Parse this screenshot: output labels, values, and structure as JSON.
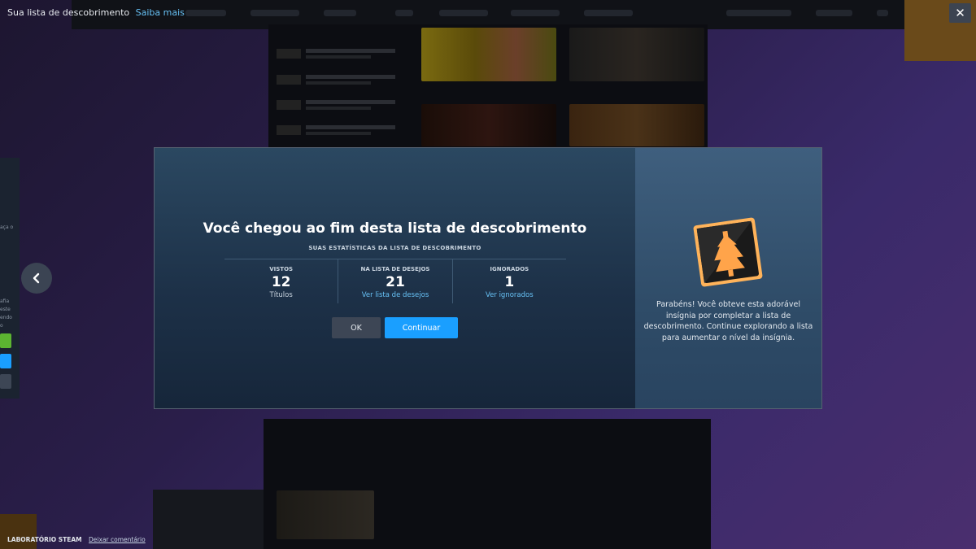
{
  "top_bar": {
    "title": "Sua lista de descobrimento",
    "learn_more": "Saiba mais"
  },
  "dialog": {
    "title": "Você chegou ao fim desta lista de descobrimento",
    "subtitle": "SUAS ESTATÍSTICAS DA LISTA DE DESCOBRIMENTO",
    "stats": [
      {
        "label": "VISTOS",
        "value": "12",
        "sub": "Títulos"
      },
      {
        "label": "NA LISTA DE DESEJOS",
        "value": "21",
        "link": "Ver lista de desejos"
      },
      {
        "label": "IGNORADOS",
        "value": "1",
        "link": "Ver ignorados"
      }
    ],
    "ok_label": "OK",
    "continue_label": "Continuar",
    "side_text": "Parabéns! Você obteve esta adorável insígnia por completar a lista de descobrimento. Continue explorando a lista para aumentar o nível da insígnia."
  },
  "footer": {
    "lab": "LABORATÓRIO STEAM",
    "feedback": "Deixar comentário"
  },
  "icons": {
    "close": "close-icon",
    "prev": "chevron-left-icon",
    "badge": "discovery-badge-icon"
  },
  "colors": {
    "accent": "#1a9fff",
    "link": "#67c1f5",
    "badge_orange": "#ffa44a"
  }
}
